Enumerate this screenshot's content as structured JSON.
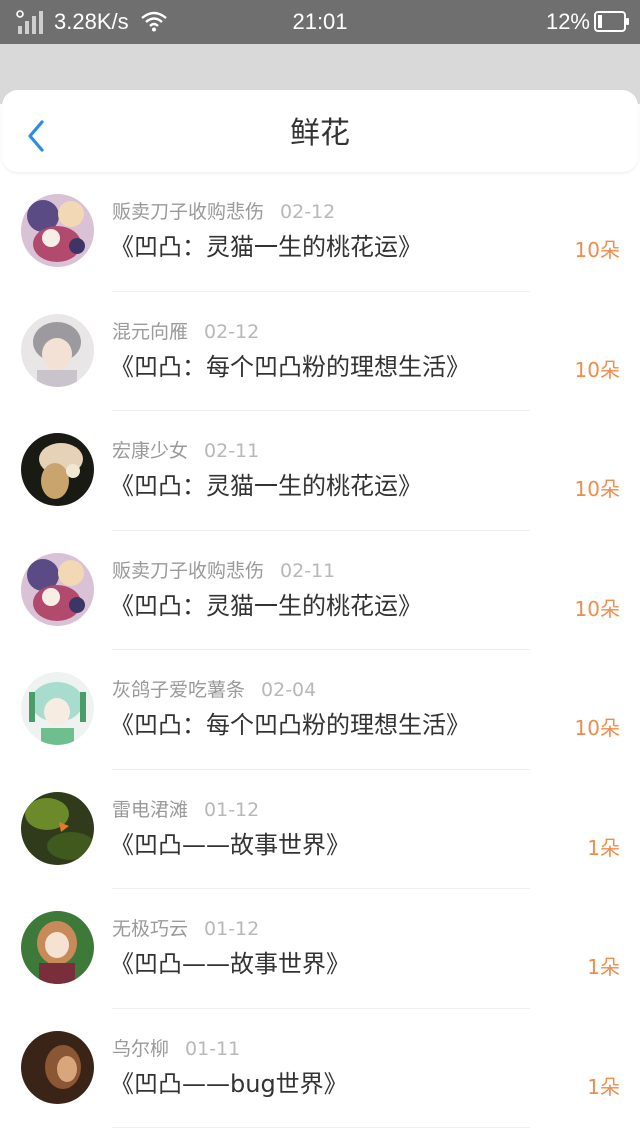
{
  "status_bar": {
    "net_speed": "3.28K/s",
    "time": "21:01",
    "battery": "12%"
  },
  "nav": {
    "title": "鲜花",
    "back_icon": "chevron-left-icon",
    "accent": "#2a8ee0"
  },
  "colors": {
    "count": "#f08c4a",
    "username": "#9a9a9a",
    "date": "#b8b8b8",
    "title": "#333333"
  },
  "items": [
    {
      "user": "贩卖刀子收购悲伤",
      "date": "02-12",
      "work": "《凹凸：灵猫一生的桃花运》",
      "count": "10朵"
    },
    {
      "user": "混元向雁",
      "date": "02-12",
      "work": "《凹凸：每个凹凸粉的理想生活》",
      "count": "10朵"
    },
    {
      "user": "宏康少女",
      "date": "02-11",
      "work": "《凹凸：灵猫一生的桃花运》",
      "count": "10朵"
    },
    {
      "user": "贩卖刀子收购悲伤",
      "date": "02-11",
      "work": "《凹凸：灵猫一生的桃花运》",
      "count": "10朵"
    },
    {
      "user": "灰鸽子爱吃薯条",
      "date": "02-04",
      "work": "《凹凸：每个凹凸粉的理想生活》",
      "count": "10朵"
    },
    {
      "user": "雷电涒滩",
      "date": "01-12",
      "work": "《凹凸——故事世界》",
      "count": "1朵"
    },
    {
      "user": "无极巧云",
      "date": "01-12",
      "work": "《凹凸——故事世界》",
      "count": "1朵"
    },
    {
      "user": "乌尔柳",
      "date": "01-11",
      "work": "《凹凸——bug世界》",
      "count": "1朵"
    }
  ]
}
